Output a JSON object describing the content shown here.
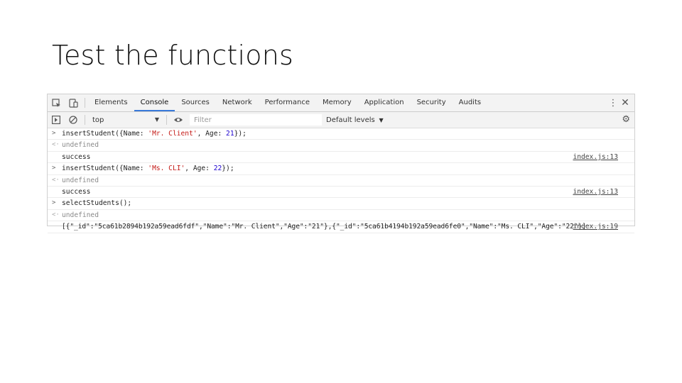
{
  "slide": {
    "title": "Test the functions"
  },
  "devtools": {
    "tabs": [
      "Elements",
      "Console",
      "Sources",
      "Network",
      "Performance",
      "Memory",
      "Application",
      "Security",
      "Audits"
    ],
    "active_tab": "Console",
    "toolbar": {
      "context": "top",
      "filter_placeholder": "Filter",
      "levels": "Default levels"
    },
    "console": {
      "r1": {
        "pre": "insertStudent({Name: ",
        "s": "'Mr. Client'",
        "mid": ", Age: ",
        "n": "21",
        "post": "});"
      },
      "r2": {
        "text": "undefined"
      },
      "r3": {
        "text": "success",
        "src": "index.js:13"
      },
      "r4": {
        "pre": "insertStudent({Name: ",
        "s": "'Ms. CLI'",
        "mid": ", Age: ",
        "n": "22",
        "post": "});"
      },
      "r5": {
        "text": "undefined"
      },
      "r6": {
        "text": "success",
        "src": "index.js:13"
      },
      "r7": {
        "text": "selectStudents();"
      },
      "r8": {
        "text": "undefined"
      },
      "r9": {
        "text": "[{\"_id\":\"5ca61b2894b192a59ead6fdf\",\"Name\":\"Mr. Client\",\"Age\":\"21\"},{\"_id\":\"5ca61b4194b192a59ead6fe0\",\"Name\":\"Ms. CLI\",\"Age\":\"22\"}]",
        "src": "index.js:19"
      }
    }
  }
}
